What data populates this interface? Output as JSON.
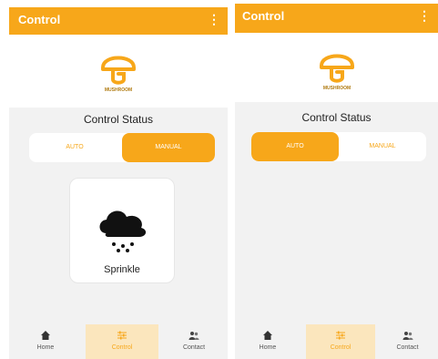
{
  "colors": {
    "accent": "#f7a71a",
    "accent_light": "#fbe6bd",
    "background": "#f2f2f2"
  },
  "left_screen": {
    "appbar": {
      "title": "Control",
      "menu_icon": "more-vertical-icon"
    },
    "logo": {
      "icon": "mushroom-logo-icon",
      "text": "MUSHROOM"
    },
    "status_title": "Control Status",
    "toggle": {
      "auto_label": "AUTO",
      "manual_label": "MANUAL",
      "selected": "MANUAL"
    },
    "card": {
      "icon": "rain-cloud-icon",
      "label": "Sprinkle"
    },
    "nav": [
      {
        "label": "Home",
        "icon": "home-icon"
      },
      {
        "label": "Control",
        "icon": "sliders-icon"
      },
      {
        "label": "Contact",
        "icon": "people-icon"
      }
    ]
  },
  "right_screen": {
    "appbar": {
      "title": "Control",
      "menu_icon": "more-vertical-icon"
    },
    "logo": {
      "icon": "mushroom-logo-icon",
      "text": "MUSHROOM"
    },
    "status_title": "Control Status",
    "toggle": {
      "auto_label": "AUTO",
      "manual_label": "MANUAL",
      "selected": "AUTO"
    },
    "nav": [
      {
        "label": "Home",
        "icon": "home-icon"
      },
      {
        "label": "Control",
        "icon": "sliders-icon"
      },
      {
        "label": "Contact",
        "icon": "people-icon"
      }
    ]
  }
}
